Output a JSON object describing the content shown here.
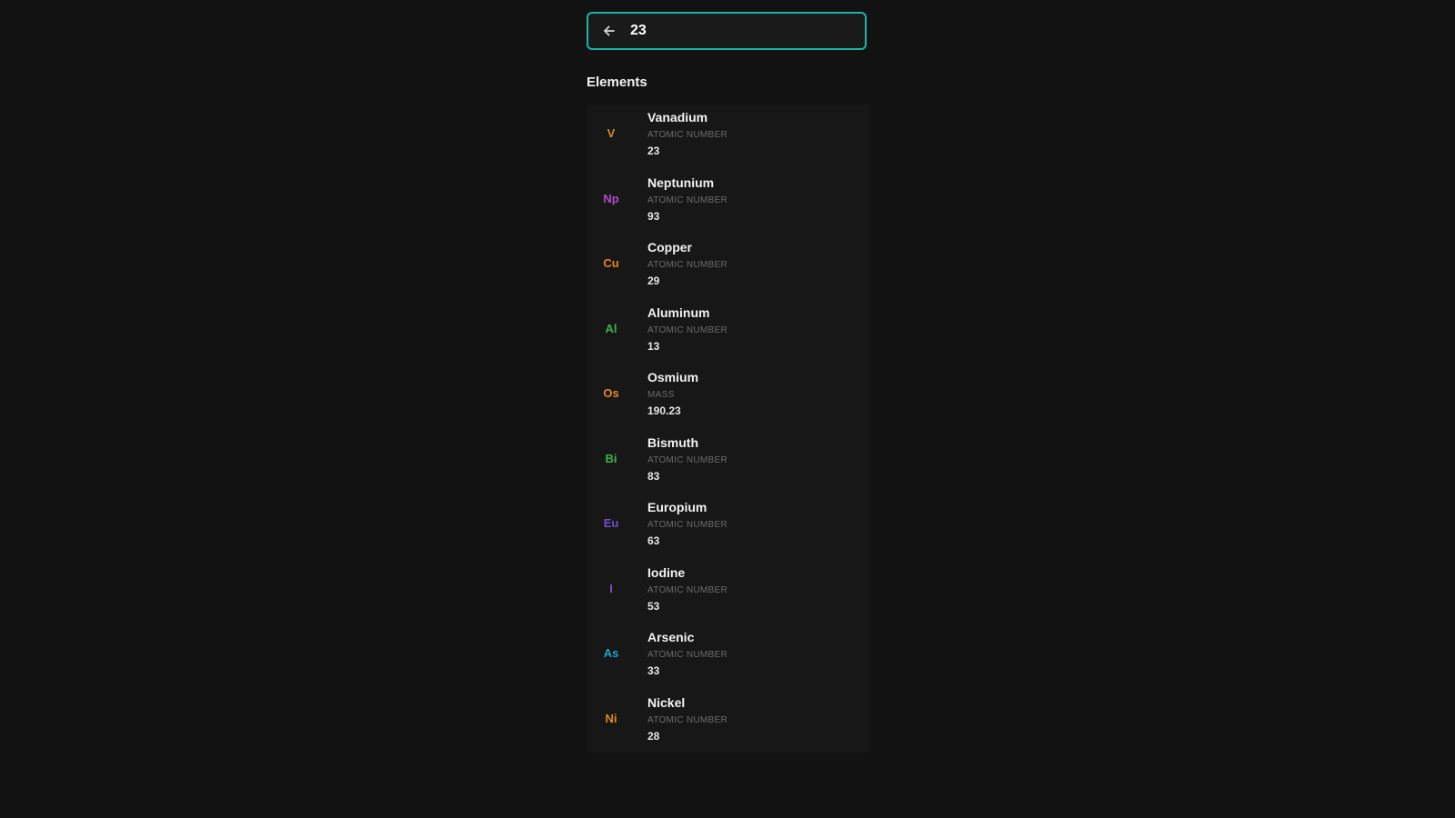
{
  "search": {
    "value": "23",
    "back_icon": "arrow-left-icon"
  },
  "section": {
    "title": "Elements"
  },
  "elements": [
    {
      "symbol": "V",
      "name": "Vanadium",
      "property": "ATOMIC NUMBER",
      "value": "23",
      "color": "#d08a2e"
    },
    {
      "symbol": "Np",
      "name": "Neptunium",
      "property": "ATOMIC NUMBER",
      "value": "93",
      "color": "#b04bc8"
    },
    {
      "symbol": "Cu",
      "name": "Copper",
      "property": "ATOMIC NUMBER",
      "value": "29",
      "color": "#e08a1e"
    },
    {
      "symbol": "Al",
      "name": "Aluminum",
      "property": "ATOMIC NUMBER",
      "value": "13",
      "color": "#3fb24a"
    },
    {
      "symbol": "Os",
      "name": "Osmium",
      "property": "MASS",
      "value": "190.23",
      "color": "#e08a1e"
    },
    {
      "symbol": "Bi",
      "name": "Bismuth",
      "property": "ATOMIC NUMBER",
      "value": "83",
      "color": "#3fb24a"
    },
    {
      "symbol": "Eu",
      "name": "Europium",
      "property": "ATOMIC NUMBER",
      "value": "63",
      "color": "#6e4fc7"
    },
    {
      "symbol": "I",
      "name": "Iodine",
      "property": "ATOMIC NUMBER",
      "value": "53",
      "color": "#7a4fc7"
    },
    {
      "symbol": "As",
      "name": "Arsenic",
      "property": "ATOMIC NUMBER",
      "value": "33",
      "color": "#1aa6c8"
    },
    {
      "symbol": "Ni",
      "name": "Nickel",
      "property": "ATOMIC NUMBER",
      "value": "28",
      "color": "#e08a1e"
    }
  ]
}
